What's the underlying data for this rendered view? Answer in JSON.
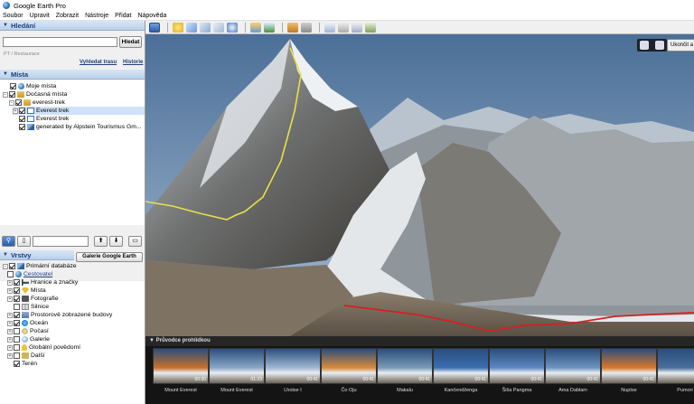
{
  "window": {
    "title": "Google Earth Pro"
  },
  "menu": [
    "Soubor",
    "Upravit",
    "Zobrazit",
    "Nástroje",
    "Přidat",
    "Nápověda"
  ],
  "search": {
    "header": "Hledání",
    "input_value": "",
    "button": "Hledat",
    "hint": "PT / Restaurace",
    "link_route": "Vyhledat trasu",
    "link_history": "Historie"
  },
  "places": {
    "header": "Místa",
    "items": [
      {
        "label": "Moje místa",
        "checked": true,
        "icon": "globe-icon"
      },
      {
        "label": "Dočasná místa",
        "checked": true,
        "icon": "folder-icon"
      },
      {
        "label": "everest-trek",
        "checked": true,
        "icon": "folder-icon"
      },
      {
        "label": "Everest trek",
        "checked": true,
        "icon": "track-icon"
      },
      {
        "label": "Everest trek",
        "checked": true,
        "icon": "track-icon"
      },
      {
        "label": "generated by Alpstein Tourismus Gm...",
        "checked": true,
        "icon": "layers-icon"
      }
    ]
  },
  "layers": {
    "header": "Vrstvy",
    "gallery_button": "Galerie Google Earth",
    "items": [
      {
        "label": "Primární databáze",
        "checked": true,
        "icon": "layers-icon"
      },
      {
        "label": "Cestovatel",
        "checked": false,
        "icon": "globe-icon",
        "link": true
      },
      {
        "label": "Hranice a značky",
        "checked": true,
        "icon": "flag-icon"
      },
      {
        "label": "Místa",
        "checked": true,
        "icon": "pin-icon"
      },
      {
        "label": "Fotografie",
        "checked": true,
        "icon": "camera-icon"
      },
      {
        "label": "Silnice",
        "checked": false,
        "icon": "road-icon"
      },
      {
        "label": "Prostorově zobrazené budovy",
        "checked": true,
        "icon": "building-icon"
      },
      {
        "label": "Oceán",
        "checked": true,
        "icon": "ocean-icon"
      },
      {
        "label": "Počasí",
        "checked": false,
        "icon": "weather-icon"
      },
      {
        "label": "Galerie",
        "checked": false,
        "icon": "gallery-icon"
      },
      {
        "label": "Globální povědomí",
        "checked": false,
        "icon": "bulb-icon"
      },
      {
        "label": "Další",
        "checked": false,
        "icon": "more-icon"
      },
      {
        "label": "Terén",
        "checked": true,
        "icon": ""
      }
    ]
  },
  "view": {
    "exit_tour": "Ukončit a"
  },
  "tour": {
    "header": "Průvodce prohlídkou",
    "items": [
      {
        "label": "Mount Everest",
        "duration": "00:30",
        "color": "#c8702a"
      },
      {
        "label": "Mount Everest",
        "duration": "01:23",
        "color": "#8aa6c6"
      },
      {
        "label": "Lhotse I",
        "duration": "00:41",
        "color": "#9fb7d3"
      },
      {
        "label": "Čo Oju",
        "duration": "00:41",
        "color": "#d98a3c"
      },
      {
        "label": "Makalu",
        "duration": "00:41",
        "color": "#7a9ab6"
      },
      {
        "label": "Kančendženga",
        "duration": "00:41",
        "color": "#3a6eb0"
      },
      {
        "label": "Šiša Pangma",
        "duration": "00:41",
        "color": "#5d88c0"
      },
      {
        "label": "Ama Dablam",
        "duration": "00:41",
        "color": "#6f93bf"
      },
      {
        "label": "Nuptse",
        "duration": "00:41",
        "color": "#d8782a"
      },
      {
        "label": "Pumori",
        "duration": "",
        "color": "#4a6e9a"
      }
    ]
  }
}
